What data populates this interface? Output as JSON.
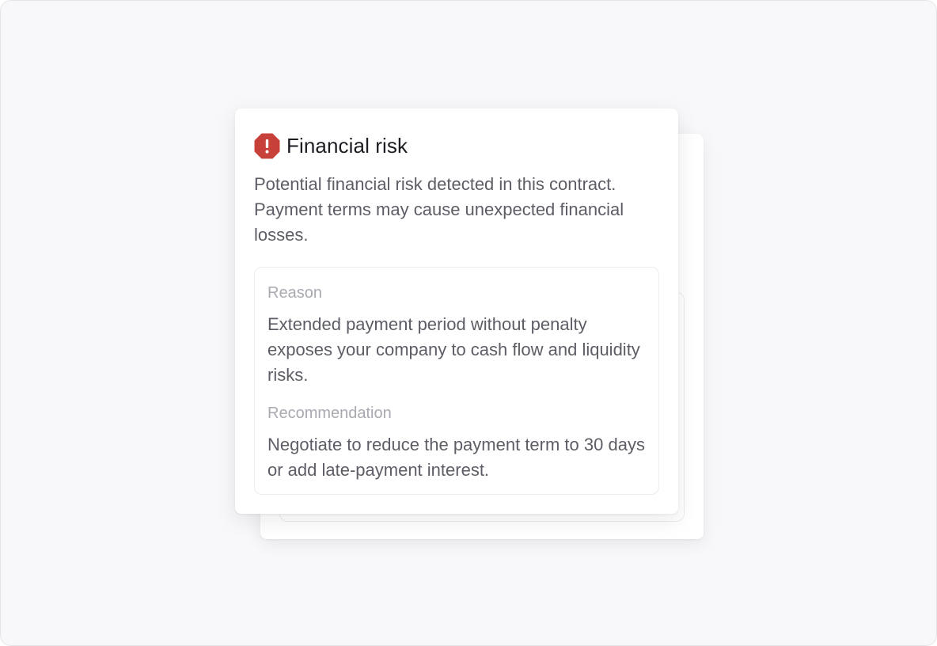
{
  "alert": {
    "icon": "alert-octagon-icon",
    "icon_color": "#c8403a",
    "title": "Financial risk",
    "description": "Potential financial risk detected in this contract. Payment terms may cause unexpected financial losses."
  },
  "details": {
    "reason_label": "Reason",
    "reason_text": "Extended payment period without penalty exposes your company to cash flow and liquidity risks.",
    "recommendation_label": "Recommendation",
    "recommendation_text": "Negotiate to reduce the payment term to 30 days or add late-payment interest."
  }
}
